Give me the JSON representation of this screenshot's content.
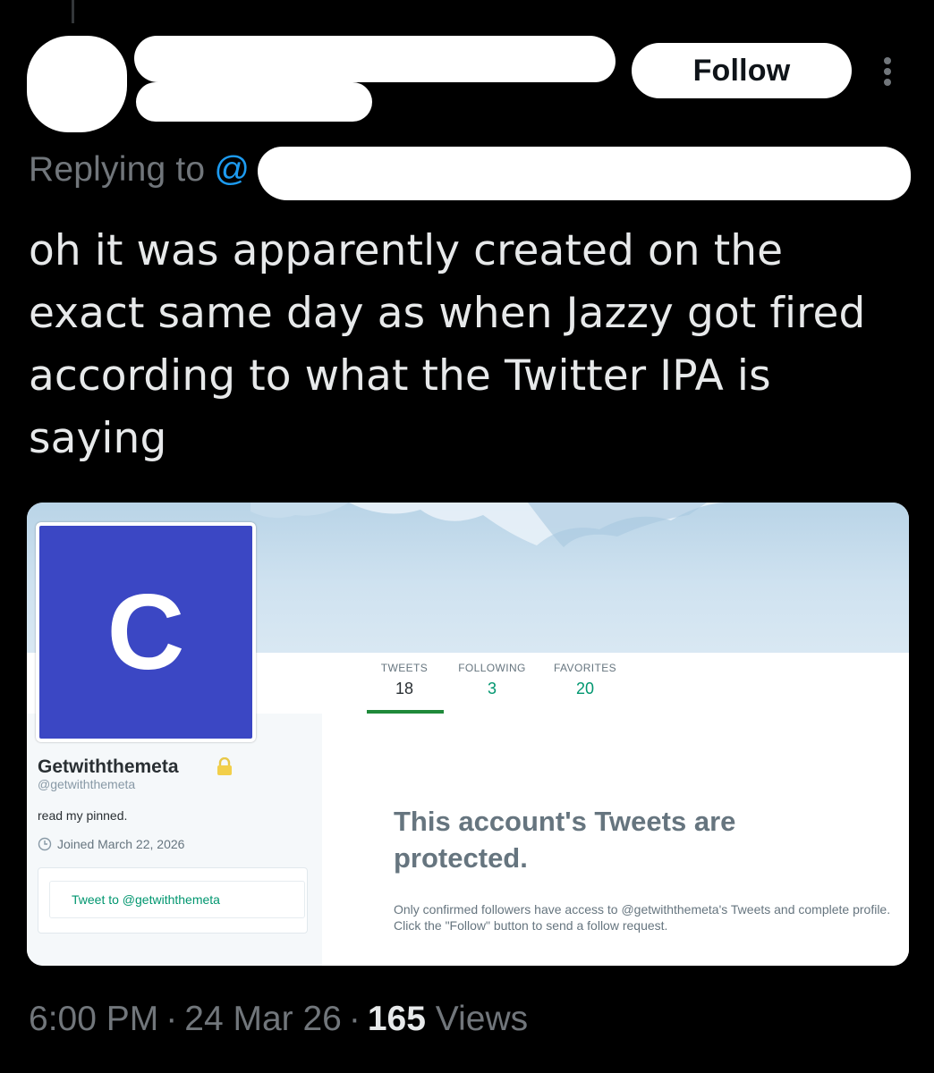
{
  "header": {
    "follow_label": "Follow"
  },
  "reply": {
    "prefix": "Replying to",
    "at_symbol": "@"
  },
  "tweet": {
    "text": "oh it was apparently created on the exact same day as when Jazzy got fired according to what the Twitter IPA is saying"
  },
  "screenshot_card": {
    "avatar_letter": "C",
    "avatar_color": "#3b47c4",
    "stats": [
      {
        "label": "TWEETS",
        "value": "18"
      },
      {
        "label": "FOLLOWING",
        "value": "3"
      },
      {
        "label": "FAVORITES",
        "value": "20"
      }
    ],
    "profile": {
      "name": "Getwiththemeta",
      "handle": "@getwiththemeta",
      "bio": "read my pinned.",
      "joined": "Joined March 22, 2026",
      "tweet_to": "Tweet to @getwiththemeta"
    },
    "protected": {
      "title": "This account's Tweets are protected.",
      "body": "Only confirmed followers have access to @getwiththemeta's Tweets and complete profile. Click the \"Follow\" button to send a follow request."
    },
    "accent_color": "#00966f"
  },
  "meta": {
    "time": "6:00 PM",
    "date": "24 Mar 26",
    "views_count": "165",
    "views_label": "Views"
  },
  "icons": [
    "more-icon",
    "lock-icon",
    "clock-icon"
  ]
}
